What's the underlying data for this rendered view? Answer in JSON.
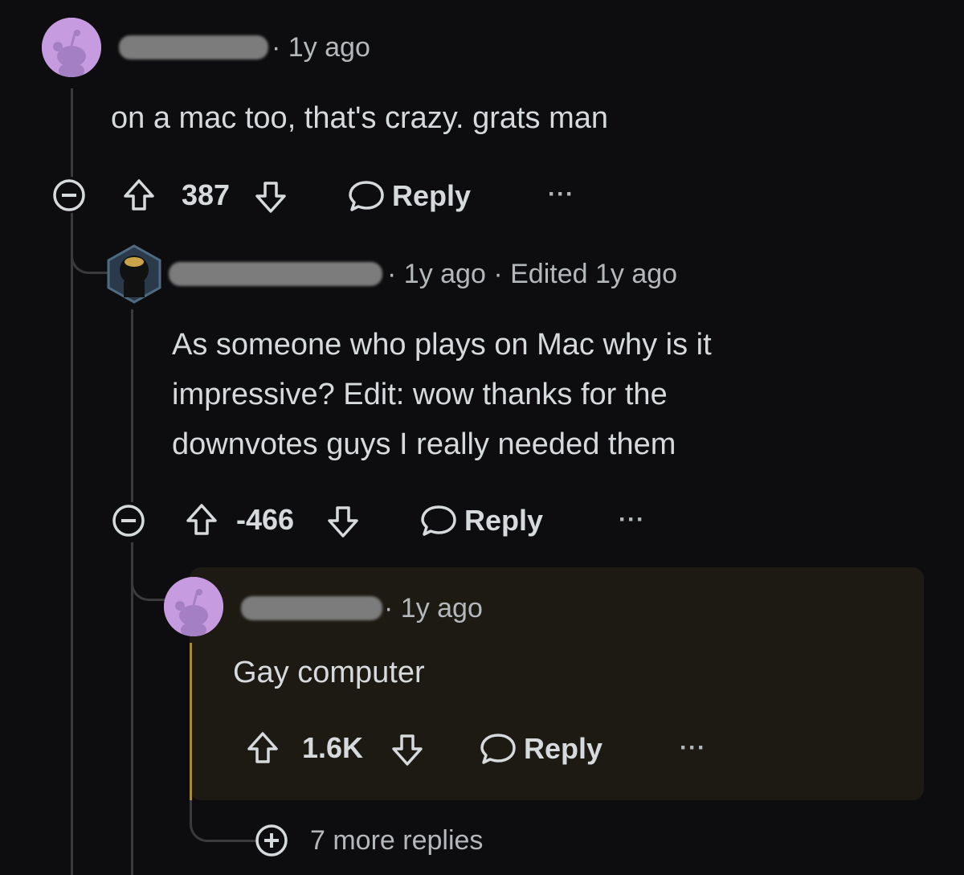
{
  "comments": [
    {
      "time": "1y ago",
      "body": "on a mac too, that's crazy. grats man",
      "score": "387",
      "reply_label": "Reply",
      "more_label": "···"
    },
    {
      "time": "1y ago",
      "edited": "Edited 1y ago",
      "body_lines": [
        "As someone who plays on Mac why is it",
        "impressive? Edit: wow thanks for the",
        "downvotes guys I really needed them"
      ],
      "score": "-466",
      "reply_label": "Reply",
      "more_label": "···"
    },
    {
      "time": "1y ago",
      "body": "Gay computer",
      "score": "1.6K",
      "reply_label": "Reply",
      "more_label": "···"
    }
  ],
  "more_replies": "7 more replies",
  "separator": "·",
  "colors": {
    "background": "#0d0d0f",
    "avatar": "#c79be0",
    "highlight": "#1c1a12",
    "accent_bar": "#a88a3a"
  }
}
